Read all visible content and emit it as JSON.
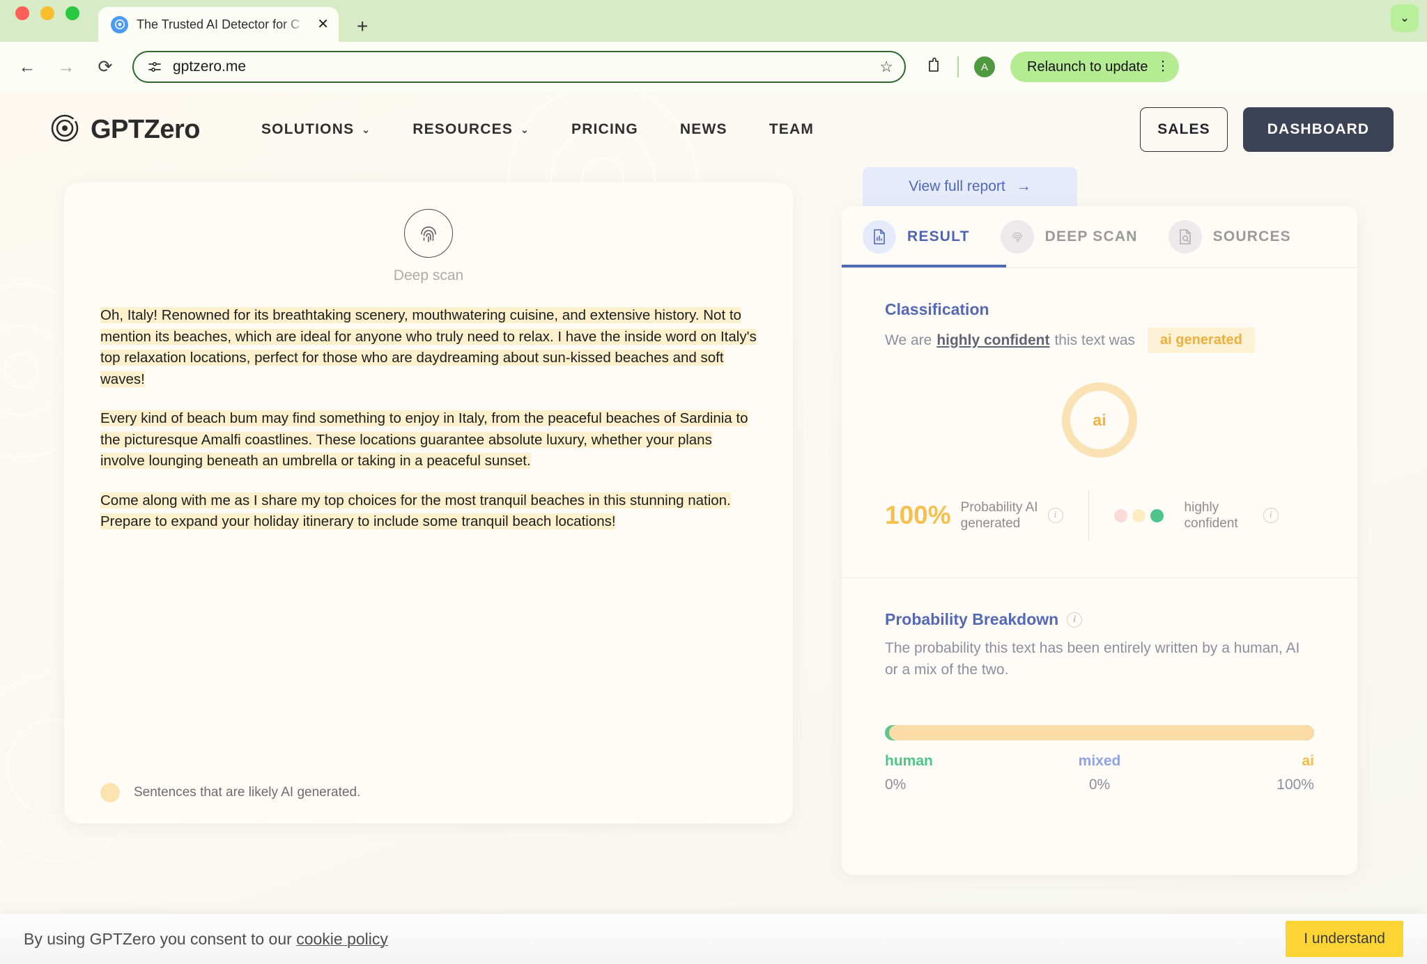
{
  "browser": {
    "tab": {
      "title": "The Trusted AI Detector for C",
      "close_label": "✕",
      "favicon": "gptzero-favicon"
    },
    "new_tab_label": "+",
    "tabstrip_chevron": "⌄",
    "back_label": "←",
    "forward_label": "→",
    "reload_label": "⟳",
    "url": "gptzero.me",
    "star_label": "☆",
    "profile_initial": "A",
    "relaunch_label": "Relaunch to update",
    "kebab_label": "⋮"
  },
  "site": {
    "brand": "GPTZero",
    "nav": [
      {
        "label": "SOLUTIONS",
        "caret": "⌄"
      },
      {
        "label": "RESOURCES",
        "caret": "⌄"
      },
      {
        "label": "PRICING",
        "caret": ""
      },
      {
        "label": "NEWS",
        "caret": ""
      },
      {
        "label": "TEAM",
        "caret": ""
      }
    ],
    "sales_label": "SALES",
    "dashboard_label": "DASHBOARD"
  },
  "editor": {
    "deep_scan_label": "Deep scan",
    "paragraphs": [
      "Oh, Italy! Renowned for its breathtaking scenery, mouthwatering cuisine, and extensive history. Not to mention its beaches, which are ideal for anyone who truly need to relax. I have the inside word on Italy's top relaxation locations, perfect for those who are daydreaming about sun-kissed beaches and soft waves!",
      "Every kind of beach bum may find something to enjoy in Italy, from the peaceful beaches of Sardinia to the picturesque Amalfi coastlines. These locations guarantee absolute luxury, whether your plans involve lounging beneath an umbrella or taking in a peaceful sunset.",
      "Come along with me as I share my top choices for the most tranquil beaches in this stunning nation. Prepare to expand your holiday itinerary to include some tranquil beach locations!"
    ],
    "legend_text": "Sentences that are likely AI generated."
  },
  "report": {
    "view_full_report": "View full report",
    "view_full_report_arrow": "→",
    "tabs": [
      {
        "label": "RESULT",
        "icon": "document-chart-icon",
        "active": true
      },
      {
        "label": "DEEP SCAN",
        "icon": "fingerprint-icon",
        "active": false
      },
      {
        "label": "SOURCES",
        "icon": "document-search-icon",
        "active": false
      }
    ],
    "classification": {
      "title": "Classification",
      "prefix": "We are",
      "emphasis": "highly confident",
      "suffix": "this text was",
      "chip": "ai generated",
      "gauge_label": "ai"
    },
    "metrics": {
      "probability_value": "100%",
      "probability_label_line1": "Probability AI",
      "probability_label_line2": "generated",
      "confidence_label_line1": "highly",
      "confidence_label_line2": "confident",
      "info_glyph": "i"
    },
    "breakdown": {
      "title": "Probability Breakdown",
      "description": "The probability this text has been entirely written by a human, AI or a mix of the two."
    }
  },
  "chart_data": {
    "type": "bar",
    "title": "Probability Breakdown",
    "categories": [
      "human",
      "mixed",
      "ai"
    ],
    "values": [
      0,
      0,
      100
    ],
    "labels": [
      "0%",
      "0%",
      "100%"
    ],
    "colors": {
      "human": "#4cc48a",
      "mixed": "#8fa2e8",
      "ai": "#f4bb4b"
    },
    "ylabel": "",
    "xlabel": "",
    "ylim": [
      0,
      100
    ]
  },
  "cookie": {
    "text_prefix": "By using GPTZero you consent to our ",
    "link": "cookie policy",
    "button": "I understand"
  }
}
